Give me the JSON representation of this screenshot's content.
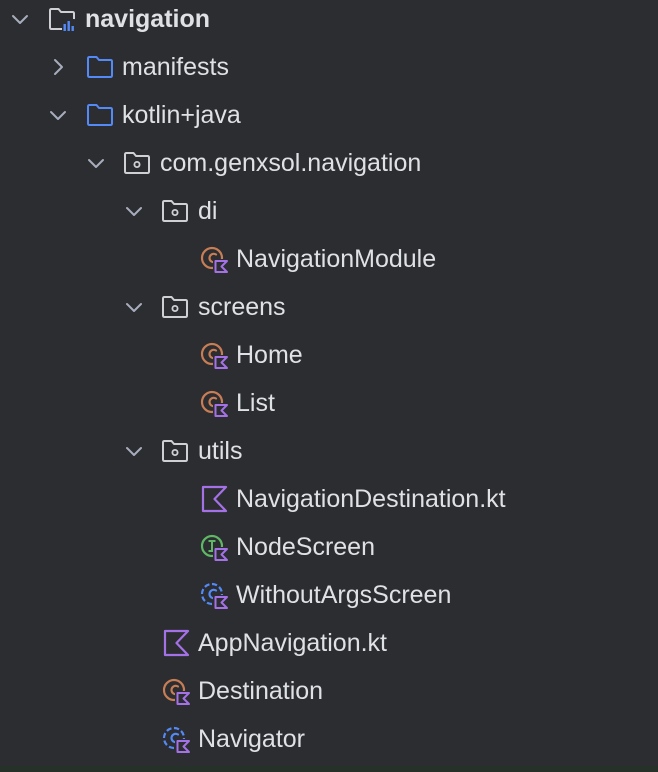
{
  "tree": {
    "root": {
      "label": "navigation",
      "icon": "module-folder-icon",
      "expanded": true
    },
    "manifests": {
      "label": "manifests",
      "icon": "folder-icon",
      "expanded": false
    },
    "kotlin_java": {
      "label": "kotlin+java",
      "icon": "folder-icon",
      "expanded": true
    },
    "package": {
      "label": "com.genxsol.navigation",
      "icon": "package-icon",
      "expanded": true
    },
    "di": {
      "label": "di",
      "icon": "package-icon",
      "expanded": true
    },
    "navigation_module": {
      "label": "NavigationModule",
      "icon": "kotlin-class-icon"
    },
    "screens": {
      "label": "screens",
      "icon": "package-icon",
      "expanded": true
    },
    "home": {
      "label": "Home",
      "icon": "kotlin-class-icon"
    },
    "list": {
      "label": "List",
      "icon": "kotlin-class-icon"
    },
    "utils": {
      "label": "utils",
      "icon": "package-icon",
      "expanded": true
    },
    "navigation_destination": {
      "label": "NavigationDestination.kt",
      "icon": "kotlin-file-icon"
    },
    "node_screen": {
      "label": "NodeScreen",
      "icon": "kotlin-interface-icon"
    },
    "without_args_screen": {
      "label": "WithoutArgsScreen",
      "icon": "kotlin-abstract-class-icon"
    },
    "app_navigation": {
      "label": "AppNavigation.kt",
      "icon": "kotlin-file-icon"
    },
    "destination": {
      "label": "Destination",
      "icon": "kotlin-class-icon"
    },
    "navigator": {
      "label": "Navigator",
      "icon": "kotlin-abstract-class-icon"
    }
  },
  "colors": {
    "background": "#2b2d30",
    "text": "#dfe1e5",
    "folder_blue": "#548af7",
    "class_orange": "#c77d55",
    "interface_green": "#5fb865",
    "kotlin_purple": "#a571e6",
    "chevron": "#a8adbd"
  }
}
